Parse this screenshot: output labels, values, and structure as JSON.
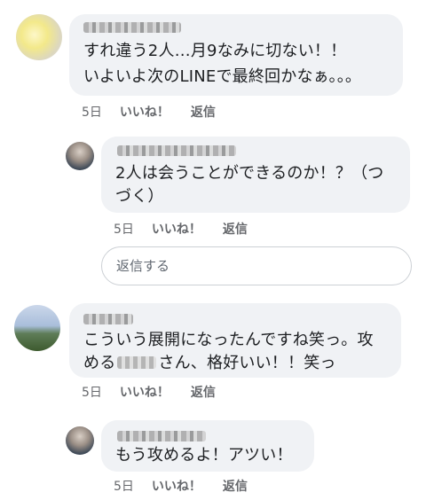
{
  "comments": [
    {
      "avatar_icon": "user-avatar-icon",
      "lines": [
        "すれ違う2人…月9なみに切ない！！",
        "いよいよ次のLINEで最終回かなぁ。。。"
      ],
      "time": "5日",
      "like_label": "いいね！",
      "reply_label": "返信"
    },
    {
      "avatar_icon": "user-avatar-icon",
      "lines": [
        "2人は会うことができるのか！？（つ",
        "づく）"
      ],
      "time": "5日",
      "like_label": "いいね！",
      "reply_label": "返信"
    },
    {
      "avatar_icon": "user-avatar-icon",
      "lines": [
        "こういう展開になったんですね笑っ。攻",
        "める",
        "さん、格好いい！！笑っ"
      ],
      "time": "5日",
      "like_label": "いいね！",
      "reply_label": "返信"
    },
    {
      "avatar_icon": "user-avatar-icon",
      "lines": [
        "もう攻めるよ！アツい！"
      ],
      "time": "5日",
      "like_label": "いいね！",
      "reply_label": "返信"
    }
  ],
  "reply_input": {
    "placeholder": "返信する",
    "value": ""
  }
}
